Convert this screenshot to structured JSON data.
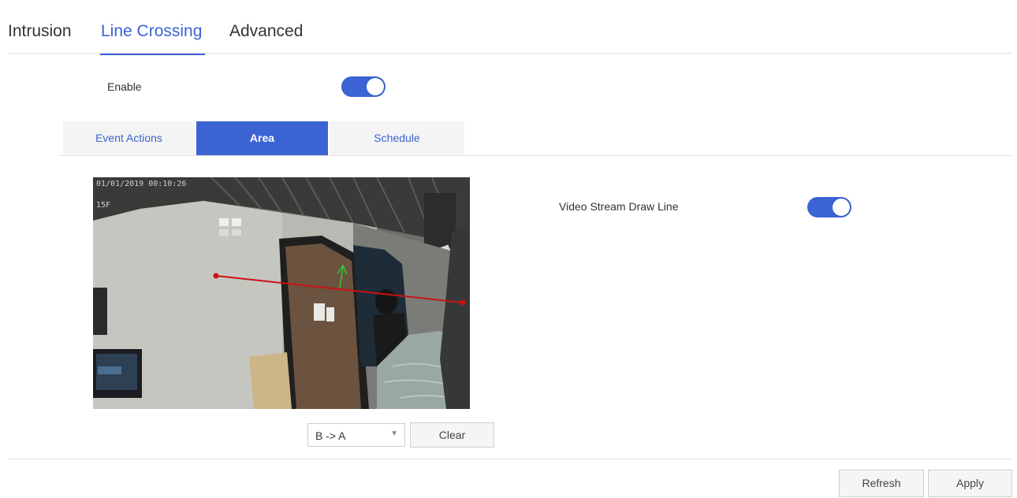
{
  "top_tabs": [
    {
      "label": "Intrusion",
      "active": false
    },
    {
      "label": "Line Crossing",
      "active": true
    },
    {
      "label": "Advanced",
      "active": false
    }
  ],
  "enable": {
    "label": "Enable",
    "on": true
  },
  "sub_tabs": [
    {
      "label": "Event Actions",
      "active": false
    },
    {
      "label": "Area",
      "active": true
    },
    {
      "label": "Schedule",
      "active": false
    }
  ],
  "video": {
    "timestamp": "01/01/2019 00:10:26",
    "osd_fps": "15F"
  },
  "draw_line": {
    "label": "Video Stream Draw Line",
    "on": true
  },
  "direction": {
    "selected": "B -> A"
  },
  "buttons": {
    "clear": "Clear",
    "refresh": "Refresh",
    "apply": "Apply"
  },
  "colors": {
    "accent": "#3b63d3",
    "line": "#cc1111",
    "arrow": "#33cc33"
  }
}
